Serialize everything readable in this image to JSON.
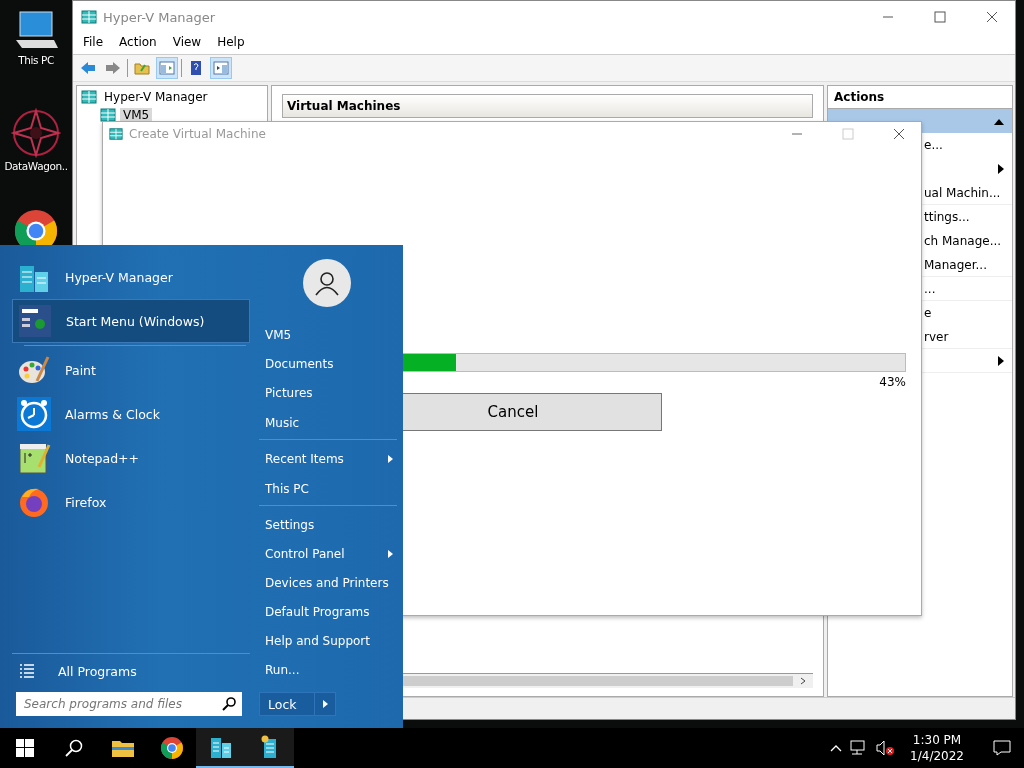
{
  "desktop_icons": [
    {
      "kind": "pc",
      "label": "This PC"
    },
    {
      "kind": "mandala",
      "label": "DataWagon.."
    },
    {
      "kind": "chrome"
    }
  ],
  "hyperv_window": {
    "title": "Hyper-V Manager",
    "menu": [
      "File",
      "Action",
      "View",
      "Help"
    ],
    "toolbar": [
      {
        "kind": "back",
        "pressed": false
      },
      {
        "kind": "forward",
        "pressed": false
      },
      {
        "kind": "folder",
        "pressed": false
      },
      {
        "kind": "tree-pane",
        "pressed": true
      },
      {
        "kind": "help",
        "pressed": false
      },
      {
        "kind": "action-pane",
        "pressed": true
      }
    ],
    "tree": {
      "label": "Hyper-V Manager",
      "children": [
        {
          "label": "VM5",
          "selected": true
        }
      ]
    },
    "center_header": "Virtual Machines",
    "actions": {
      "header": "Actions",
      "items": [
        {
          "label": "e...",
          "submenu": false,
          "divider_after": false
        },
        {
          "submenu": true,
          "divider_after": false
        },
        {
          "label": "ual Machin...",
          "submenu": false,
          "divider_after": true
        },
        {
          "label": "ttings...",
          "submenu": false,
          "divider_after": false
        },
        {
          "label": "ch Manage...",
          "submenu": false,
          "divider_after": false
        },
        {
          "label": "Manager...",
          "submenu": false,
          "divider_after": true
        },
        {
          "label": "...",
          "submenu": false,
          "divider_after": true
        },
        {
          "label": "e",
          "submenu": false,
          "divider_after": false
        },
        {
          "label": "rver",
          "submenu": false,
          "divider_after": true
        },
        {
          "submenu": true,
          "divider_after": true
        }
      ]
    }
  },
  "dialog": {
    "title": "Create Virtual Machine",
    "progress": {
      "level": 0.43,
      "reading": "43%"
    },
    "button": "Cancel"
  },
  "start_menu": {
    "programs": [
      {
        "kind": "hyperv",
        "label": "Hyper-V Manager",
        "selected": false
      },
      {
        "kind": "startmenu",
        "label": "Start Menu (Windows)",
        "selected": true
      },
      {
        "kind": "paint",
        "label": "Paint",
        "selected": false
      },
      {
        "kind": "clock",
        "label": "Alarms & Clock",
        "selected": false
      },
      {
        "kind": "notepad",
        "label": "Notepad++",
        "selected": false
      },
      {
        "kind": "firefox",
        "label": "Firefox",
        "selected": false
      }
    ],
    "all_programs": "All Programs",
    "search": {
      "placeholder": "Search programs and files"
    },
    "places": [
      {
        "label": "VM5",
        "submenu": false,
        "divider_after": false
      },
      {
        "label": "Documents",
        "submenu": false,
        "divider_after": false
      },
      {
        "label": "Pictures",
        "submenu": false,
        "divider_after": false
      },
      {
        "label": "Music",
        "submenu": false,
        "divider_after": true
      },
      {
        "label": "Recent Items",
        "submenu": true,
        "divider_after": false
      },
      {
        "label": "This PC",
        "submenu": false,
        "divider_after": true
      },
      {
        "label": "Settings",
        "submenu": false,
        "divider_after": false
      },
      {
        "label": "Control Panel",
        "submenu": true,
        "divider_after": false
      },
      {
        "label": "Devices and Printers",
        "submenu": false,
        "divider_after": false
      },
      {
        "label": "Default Programs",
        "submenu": false,
        "divider_after": false
      },
      {
        "label": "Help and Support",
        "submenu": false,
        "divider_after": false
      },
      {
        "label": "Run...",
        "submenu": false,
        "divider_after": false
      }
    ],
    "power_button": "Lock"
  },
  "taskbar": {
    "apps": [
      {
        "kind": "start",
        "running": false
      },
      {
        "kind": "search",
        "running": false
      },
      {
        "kind": "explorer",
        "running": false
      },
      {
        "kind": "chrome",
        "running": false
      },
      {
        "kind": "hyperv",
        "running": true
      },
      {
        "kind": "vm",
        "running": true
      }
    ],
    "volume_muted": true,
    "time": "1:30 PM",
    "date": "1/4/2022"
  }
}
